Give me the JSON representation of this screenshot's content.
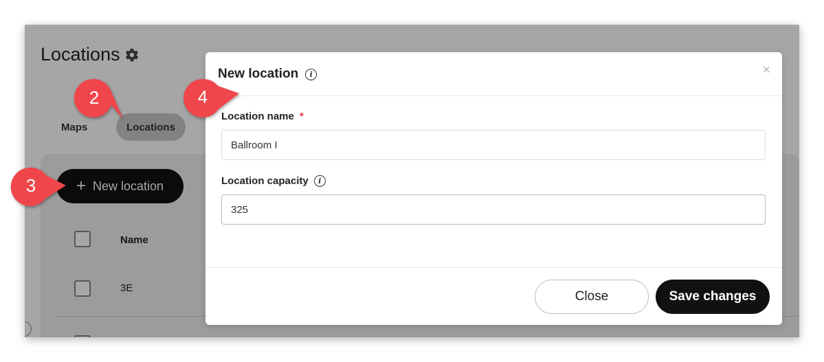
{
  "page": {
    "title": "Locations"
  },
  "tabs": [
    {
      "label": "Maps",
      "active": false
    },
    {
      "label": "Locations",
      "active": true
    }
  ],
  "toolbar": {
    "new_location_label": "New location",
    "new_location_icon": "plus-icon"
  },
  "table": {
    "columns": [
      "Name"
    ],
    "rows": [
      {
        "name": "3E"
      }
    ]
  },
  "modal": {
    "title": "New location",
    "fields": {
      "location_name": {
        "label": "Location name",
        "required_marker": "*",
        "value": "Ballroom I"
      },
      "location_capacity": {
        "label": "Location capacity",
        "value": "325"
      }
    },
    "buttons": {
      "close": "Close",
      "save": "Save changes"
    },
    "close_icon": "×"
  },
  "callouts": [
    {
      "number": "2"
    },
    {
      "number": "3"
    },
    {
      "number": "4"
    }
  ],
  "colors": {
    "callout": "#f0464b",
    "required": "#e53935",
    "primary_button": "#111111"
  }
}
